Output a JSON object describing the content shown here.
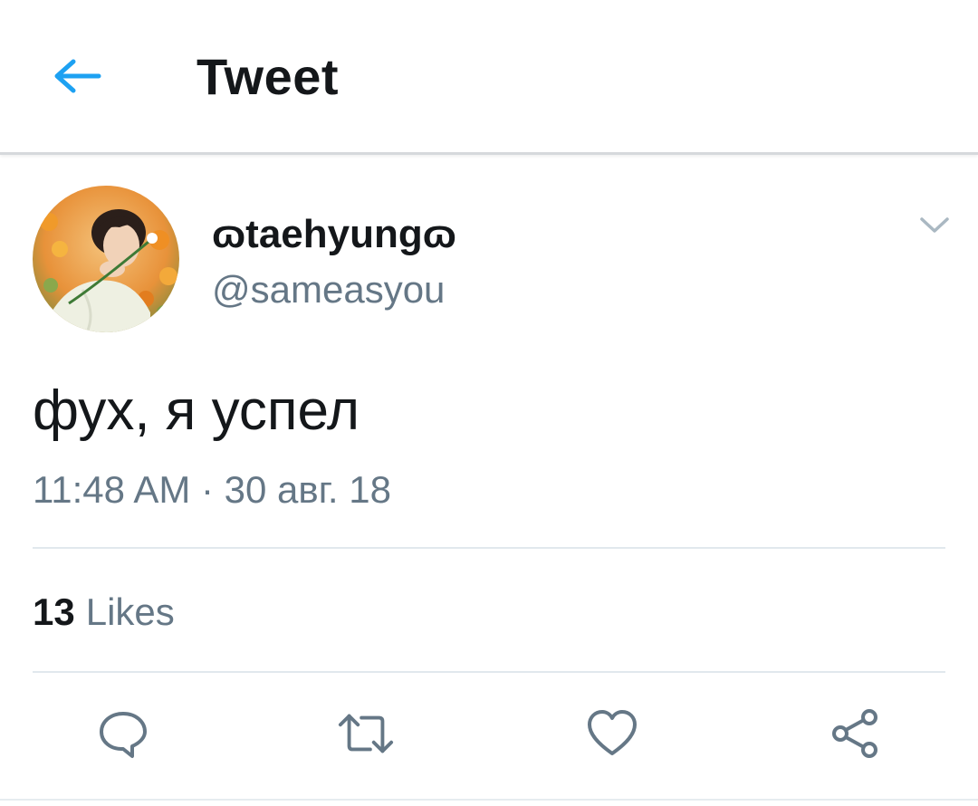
{
  "header": {
    "back_icon": "arrow-left-icon",
    "title": "Tweet",
    "accent_color": "#1da1f2"
  },
  "tweet": {
    "display_name": "ɷtaehyungɷ",
    "handle": "@sameasyou",
    "text": "фух, я успел",
    "timestamp": "11:48 AM · 30 авг. 18",
    "likes_count": "13",
    "likes_label": "Likes",
    "menu_icon": "chevron-down-icon"
  },
  "actions": [
    {
      "name": "reply",
      "icon": "comment-icon"
    },
    {
      "name": "retweet",
      "icon": "retweet-icon"
    },
    {
      "name": "like",
      "icon": "heart-icon"
    },
    {
      "name": "share",
      "icon": "share-icon"
    }
  ],
  "colors": {
    "text_primary": "#14171a",
    "text_secondary": "#657786",
    "divider": "#e1e8ed"
  }
}
